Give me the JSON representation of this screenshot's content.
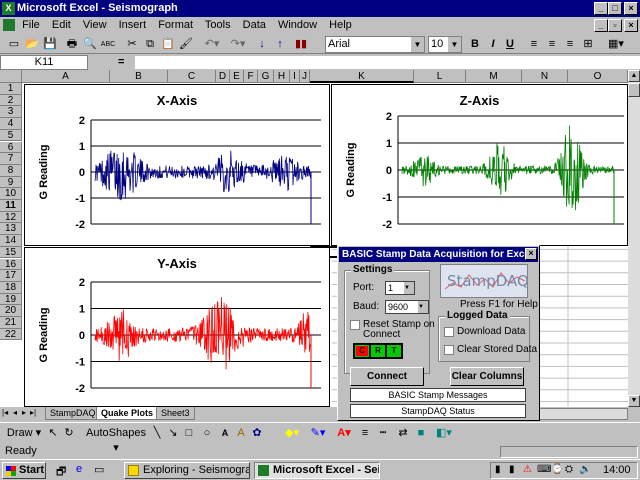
{
  "window": {
    "title": "Microsoft Excel - Seismograph"
  },
  "menu": [
    "File",
    "Edit",
    "View",
    "Insert",
    "Format",
    "Tools",
    "Data",
    "Window",
    "Help"
  ],
  "toolbar": {
    "font": "Arial",
    "size": "10",
    "bold": "B",
    "italic": "I",
    "underline": "U"
  },
  "formula": {
    "cell": "K11",
    "equals": "=",
    "value": ""
  },
  "columns": [
    "A",
    "B",
    "C",
    "D",
    "E",
    "F",
    "G",
    "H",
    "I",
    "J",
    "K",
    "L",
    "M",
    "N",
    "O"
  ],
  "rows": [
    "1",
    "2",
    "3",
    "4",
    "5",
    "6",
    "7",
    "8",
    "9",
    "10",
    "11",
    "12",
    "13",
    "14",
    "15",
    "16",
    "17",
    "18",
    "19",
    "20",
    "21",
    "22"
  ],
  "charts": [
    {
      "title": "X-Axis",
      "ylabel": "G Reading",
      "color": "#000080",
      "ticks": [
        "2",
        "1",
        "0",
        "-1",
        "-2"
      ]
    },
    {
      "title": "Z-Axis",
      "ylabel": "G Reading",
      "color": "#008000",
      "ticks": [
        "2",
        "1",
        "0",
        "-1",
        "-2"
      ]
    },
    {
      "title": "Y-Axis",
      "ylabel": "G Reading",
      "color": "#ff0000",
      "ticks": [
        "2",
        "1",
        "0",
        "-1",
        "-2"
      ]
    }
  ],
  "chart_data": [
    {
      "type": "line",
      "title": "X-Axis",
      "ylabel": "G Reading",
      "ylim": [
        -2,
        2
      ],
      "yticks": [
        2,
        1,
        0,
        -1,
        -2
      ],
      "grid": true,
      "series": [
        {
          "values": "noisy seismograph trace, amplitude up to about 1.5"
        }
      ]
    },
    {
      "type": "line",
      "title": "Z-Axis",
      "ylabel": "G Reading",
      "ylim": [
        -2,
        2
      ],
      "yticks": [
        2,
        1,
        0,
        -1,
        -2
      ],
      "grid": true,
      "series": [
        {
          "values": "noisy seismograph trace, amplitude up to about 1.8"
        }
      ]
    },
    {
      "type": "line",
      "title": "Y-Axis",
      "ylabel": "G Reading",
      "ylim": [
        -2,
        2
      ],
      "yticks": [
        2,
        1,
        0,
        -1,
        -2
      ],
      "grid": true,
      "series": [
        {
          "values": "noisy seismograph trace, amplitude up to about 1.7"
        }
      ]
    }
  ],
  "tabs": [
    "StampDAQ",
    "Quake Plots",
    "Sheet3"
  ],
  "dialog": {
    "title": "BASIC Stamp Data Acquisition for Excel",
    "settings": "Settings",
    "port_label": "Port:",
    "port_value": "1",
    "baud_label": "Baud:",
    "baud_value": "9600",
    "reset_label": "Reset Stamp on",
    "reset_label2": "Connect",
    "indicators": [
      "C",
      "R",
      "T"
    ],
    "logo": "StampDAQ",
    "help": "Press F1 for Help",
    "logged": "Logged Data",
    "download": "Download Data",
    "clear_stored": "Clear Stored Data",
    "connect": "Connect",
    "clear_columns": "Clear Columns",
    "messages": "BASIC Stamp Messages",
    "status": "StampDAQ Status"
  },
  "drawbar": {
    "draw": "Draw",
    "autoshapes": "AutoShapes"
  },
  "status": {
    "text": "Ready"
  },
  "taskbar": {
    "start": "Start",
    "tasks": [
      "Exploring - Seismograph",
      "Microsoft Excel - Seis..."
    ],
    "time": "14:00"
  }
}
